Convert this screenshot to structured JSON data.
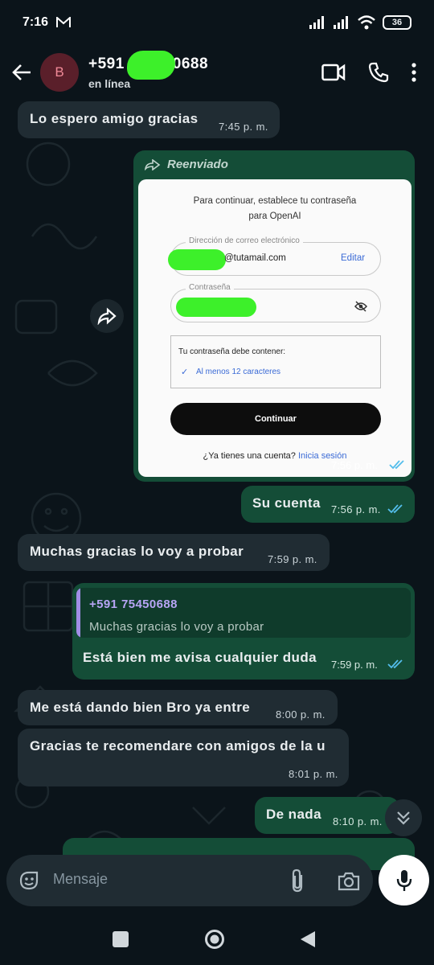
{
  "status_bar": {
    "time": "7:16",
    "battery": "36"
  },
  "header": {
    "avatar_letter": "B",
    "contact_name_prefix": "+591",
    "contact_name_suffix": "0688",
    "contact_status": "en línea"
  },
  "messages": [
    {
      "dir": "in",
      "text": "Lo espero amigo gracias",
      "time": "7:45 p. m."
    },
    {
      "dir": "out",
      "forwarded_label": "Reenviado",
      "time": "7:56 p. m.",
      "image": {
        "heading_line1": "Para continuar, establece tu contraseña",
        "heading_line2": "para OpenAI",
        "email_legend": "Dirección de correo electrónico",
        "email_value": "@tutamail.com",
        "email_edit": "Editar",
        "password_legend": "Contraseña",
        "requirements_title": "Tu contraseña debe contener:",
        "requirement_1": "Al menos 12 caracteres",
        "continue_label": "Continuar",
        "login_prompt": "¿Ya tienes una cuenta?",
        "login_link": "Inicia sesión"
      }
    },
    {
      "dir": "out",
      "text": "Su cuenta",
      "time": "7:56 p. m."
    },
    {
      "dir": "in",
      "text": "Muchas gracias lo voy a probar",
      "time": "7:59 p. m."
    },
    {
      "dir": "out",
      "quote_name": "+591 75450688",
      "quote_text": "Muchas gracias lo voy a probar",
      "text": "Está bien me avisa cualquier duda",
      "time": "7:59 p. m."
    },
    {
      "dir": "in",
      "text": "Me está dando bien Bro ya entre",
      "time": "8:00 p. m."
    },
    {
      "dir": "in",
      "text": "Gracias te recomendare con amigos de la u",
      "time": "8:01 p. m."
    },
    {
      "dir": "out",
      "text": "De nada",
      "time": "8:10 p. m."
    }
  ],
  "input": {
    "placeholder": "Mensaje"
  },
  "colors": {
    "background": "#0b141a",
    "incoming": "#202c33",
    "outgoing": "#144d37",
    "read_ticks": "#53bdeb",
    "quote_accent": "#a18ee6"
  }
}
